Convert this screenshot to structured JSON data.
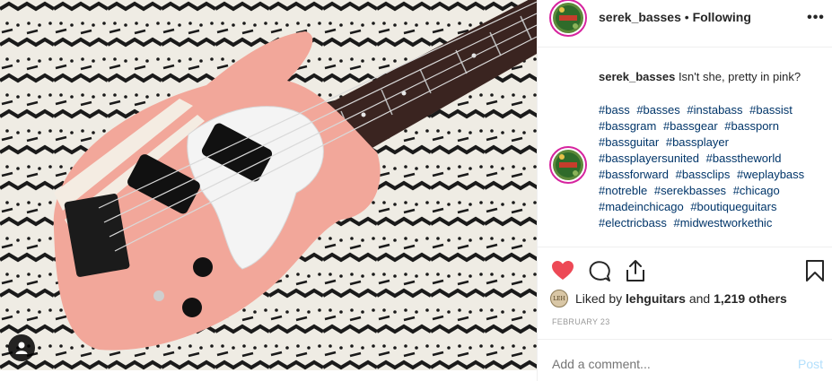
{
  "post": {
    "username": "serek_basses",
    "separator": "•",
    "follow_status": "Following",
    "more_icon": "more-options-icon"
  },
  "caption": {
    "username": "serek_basses",
    "text": "Isn't she, pretty in pink?",
    "hashtags": [
      "#bass",
      "#basses",
      "#instabass",
      "#bassist",
      "#bassgram",
      "#bassgear",
      "#bassporn",
      "#bassguitar",
      "#bassplayer",
      "#bassplayersunited",
      "#basstheworld",
      "#bassforward",
      "#bassclips",
      "#weplaybass",
      "#notreble",
      "#serekbasses",
      "#chicago",
      "#madeinchicago",
      "#boutiqueguitars",
      "#electricbass",
      "#midwestworkethic"
    ]
  },
  "actions": {
    "like_icon": "heart-filled-icon",
    "comment_icon": "comment-icon",
    "share_icon": "share-icon",
    "save_icon": "bookmark-icon"
  },
  "likes": {
    "prefix": "Liked by",
    "user": "lehguitars",
    "middle": "and",
    "count": "1,219 others"
  },
  "date": "FEBRUARY 23",
  "comment": {
    "placeholder": "Add a comment...",
    "post_label": "Post"
  },
  "colors": {
    "heart": "#ed4956",
    "hashtag": "#003569",
    "muted": "#999999",
    "post_disabled": "#b2dffc",
    "bass_body": "#f2a79a"
  }
}
